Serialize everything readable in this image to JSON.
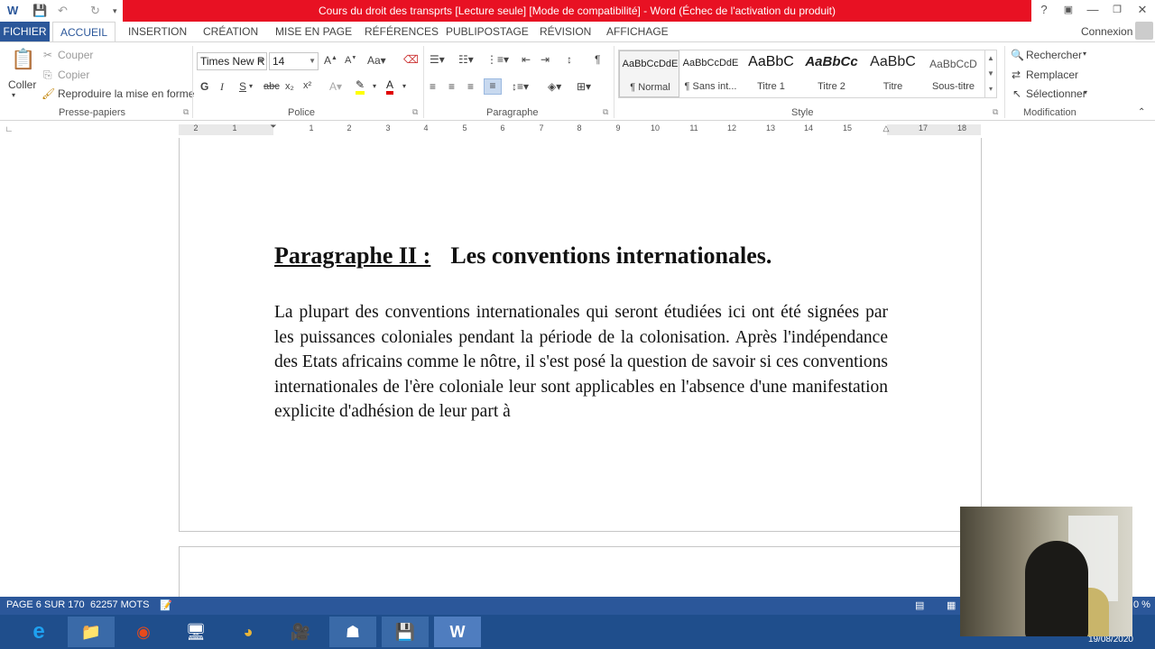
{
  "window": {
    "title": "Cours du droit des transprts [Lecture seule] [Mode de compatibilité] -  Word (Échec de l'activation du produit)",
    "help": "?",
    "connexion": "Connexion"
  },
  "tabs": [
    "FICHIER",
    "ACCUEIL",
    "INSERTION",
    "CRÉATION",
    "MISE EN PAGE",
    "RÉFÉRENCES",
    "PUBLIPOSTAGE",
    "RÉVISION",
    "AFFICHAGE"
  ],
  "clipboard": {
    "paste": "Coller",
    "cut": "Couper",
    "copy": "Copier",
    "format_painter": "Reproduire la mise en forme",
    "group": "Presse-papiers"
  },
  "font": {
    "name": "Times New R",
    "size": "14",
    "group": "Police"
  },
  "paragraph": {
    "group": "Paragraphe"
  },
  "styles": {
    "group": "Style",
    "items": [
      {
        "preview": "AaBbCcDdE",
        "name": "¶ Normal"
      },
      {
        "preview": "AaBbCcDdE",
        "name": "¶ Sans int..."
      },
      {
        "preview": "AaBbC",
        "name": "Titre 1"
      },
      {
        "preview": "AaBbCc",
        "name": "Titre 2"
      },
      {
        "preview": "AaBbC",
        "name": "Titre"
      },
      {
        "preview": "AaBbCcD",
        "name": "Sous-titre"
      }
    ]
  },
  "editing": {
    "find": "Rechercher",
    "replace": "Remplacer",
    "select": "Sélectionner",
    "group": "Modification"
  },
  "ruler": {
    "ticks": [
      "2",
      "1",
      "1",
      "2",
      "3",
      "4",
      "5",
      "6",
      "7",
      "8",
      "9",
      "10",
      "11",
      "12",
      "13",
      "14",
      "15",
      "17",
      "18"
    ]
  },
  "document": {
    "heading_underlined": "Paragraphe II :",
    "heading_rest": "Les conventions internationales.",
    "body": "La plupart des conventions internationales qui seront étudiées ici ont été signées par les puissances coloniales pendant la période de la colonisation. Après l'indépendance des Etats africains comme le nôtre, il s'est posé la question de savoir si ces conventions internationales de l'ère coloniale leur sont applicables en l'absence d'une manifestation explicite d'adhésion de leur part à"
  },
  "status": {
    "page": "PAGE 6 SUR 170",
    "words": "62257 MOTS",
    "zoom": "0 %"
  },
  "taskbar": {
    "date": "19/08/2020"
  }
}
